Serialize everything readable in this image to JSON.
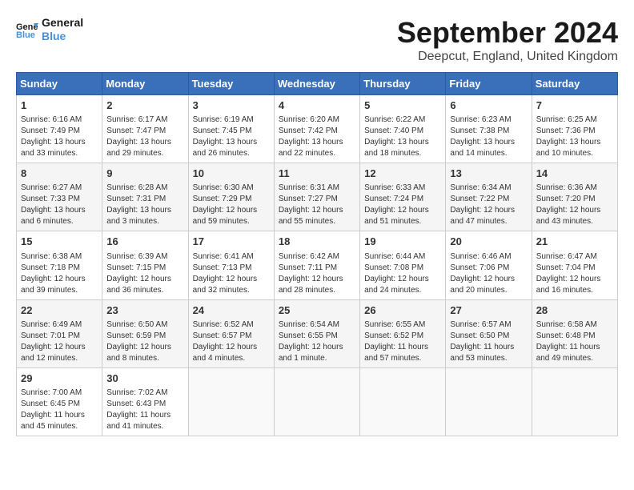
{
  "header": {
    "logo_general": "General",
    "logo_blue": "Blue",
    "month_title": "September 2024",
    "location": "Deepcut, England, United Kingdom"
  },
  "calendar": {
    "days_of_week": [
      "Sunday",
      "Monday",
      "Tuesday",
      "Wednesday",
      "Thursday",
      "Friday",
      "Saturday"
    ],
    "weeks": [
      [
        {
          "day": "",
          "info": ""
        },
        {
          "day": "2",
          "info": "Sunrise: 6:17 AM\nSunset: 7:47 PM\nDaylight: 13 hours\nand 29 minutes."
        },
        {
          "day": "3",
          "info": "Sunrise: 6:19 AM\nSunset: 7:45 PM\nDaylight: 13 hours\nand 26 minutes."
        },
        {
          "day": "4",
          "info": "Sunrise: 6:20 AM\nSunset: 7:42 PM\nDaylight: 13 hours\nand 22 minutes."
        },
        {
          "day": "5",
          "info": "Sunrise: 6:22 AM\nSunset: 7:40 PM\nDaylight: 13 hours\nand 18 minutes."
        },
        {
          "day": "6",
          "info": "Sunrise: 6:23 AM\nSunset: 7:38 PM\nDaylight: 13 hours\nand 14 minutes."
        },
        {
          "day": "7",
          "info": "Sunrise: 6:25 AM\nSunset: 7:36 PM\nDaylight: 13 hours\nand 10 minutes."
        }
      ],
      [
        {
          "day": "8",
          "info": "Sunrise: 6:27 AM\nSunset: 7:33 PM\nDaylight: 13 hours\nand 6 minutes."
        },
        {
          "day": "9",
          "info": "Sunrise: 6:28 AM\nSunset: 7:31 PM\nDaylight: 13 hours\nand 3 minutes."
        },
        {
          "day": "10",
          "info": "Sunrise: 6:30 AM\nSunset: 7:29 PM\nDaylight: 12 hours\nand 59 minutes."
        },
        {
          "day": "11",
          "info": "Sunrise: 6:31 AM\nSunset: 7:27 PM\nDaylight: 12 hours\nand 55 minutes."
        },
        {
          "day": "12",
          "info": "Sunrise: 6:33 AM\nSunset: 7:24 PM\nDaylight: 12 hours\nand 51 minutes."
        },
        {
          "day": "13",
          "info": "Sunrise: 6:34 AM\nSunset: 7:22 PM\nDaylight: 12 hours\nand 47 minutes."
        },
        {
          "day": "14",
          "info": "Sunrise: 6:36 AM\nSunset: 7:20 PM\nDaylight: 12 hours\nand 43 minutes."
        }
      ],
      [
        {
          "day": "15",
          "info": "Sunrise: 6:38 AM\nSunset: 7:18 PM\nDaylight: 12 hours\nand 39 minutes."
        },
        {
          "day": "16",
          "info": "Sunrise: 6:39 AM\nSunset: 7:15 PM\nDaylight: 12 hours\nand 36 minutes."
        },
        {
          "day": "17",
          "info": "Sunrise: 6:41 AM\nSunset: 7:13 PM\nDaylight: 12 hours\nand 32 minutes."
        },
        {
          "day": "18",
          "info": "Sunrise: 6:42 AM\nSunset: 7:11 PM\nDaylight: 12 hours\nand 28 minutes."
        },
        {
          "day": "19",
          "info": "Sunrise: 6:44 AM\nSunset: 7:08 PM\nDaylight: 12 hours\nand 24 minutes."
        },
        {
          "day": "20",
          "info": "Sunrise: 6:46 AM\nSunset: 7:06 PM\nDaylight: 12 hours\nand 20 minutes."
        },
        {
          "day": "21",
          "info": "Sunrise: 6:47 AM\nSunset: 7:04 PM\nDaylight: 12 hours\nand 16 minutes."
        }
      ],
      [
        {
          "day": "22",
          "info": "Sunrise: 6:49 AM\nSunset: 7:01 PM\nDaylight: 12 hours\nand 12 minutes."
        },
        {
          "day": "23",
          "info": "Sunrise: 6:50 AM\nSunset: 6:59 PM\nDaylight: 12 hours\nand 8 minutes."
        },
        {
          "day": "24",
          "info": "Sunrise: 6:52 AM\nSunset: 6:57 PM\nDaylight: 12 hours\nand 4 minutes."
        },
        {
          "day": "25",
          "info": "Sunrise: 6:54 AM\nSunset: 6:55 PM\nDaylight: 12 hours\nand 1 minute."
        },
        {
          "day": "26",
          "info": "Sunrise: 6:55 AM\nSunset: 6:52 PM\nDaylight: 11 hours\nand 57 minutes."
        },
        {
          "day": "27",
          "info": "Sunrise: 6:57 AM\nSunset: 6:50 PM\nDaylight: 11 hours\nand 53 minutes."
        },
        {
          "day": "28",
          "info": "Sunrise: 6:58 AM\nSunset: 6:48 PM\nDaylight: 11 hours\nand 49 minutes."
        }
      ],
      [
        {
          "day": "29",
          "info": "Sunrise: 7:00 AM\nSunset: 6:45 PM\nDaylight: 11 hours\nand 45 minutes."
        },
        {
          "day": "30",
          "info": "Sunrise: 7:02 AM\nSunset: 6:43 PM\nDaylight: 11 hours\nand 41 minutes."
        },
        {
          "day": "",
          "info": ""
        },
        {
          "day": "",
          "info": ""
        },
        {
          "day": "",
          "info": ""
        },
        {
          "day": "",
          "info": ""
        },
        {
          "day": "",
          "info": ""
        }
      ]
    ],
    "first_week_first_day": {
      "day": "1",
      "info": "Sunrise: 6:16 AM\nSunset: 7:49 PM\nDaylight: 13 hours\nand 33 minutes."
    }
  }
}
